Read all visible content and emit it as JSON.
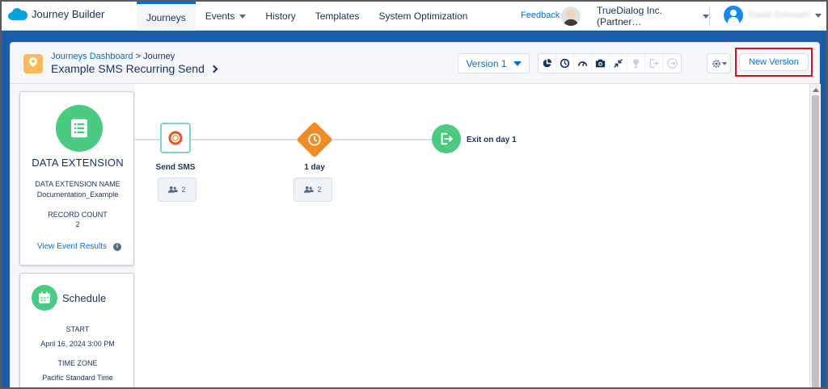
{
  "app": {
    "name": "Journey Builder"
  },
  "nav": {
    "tabs": [
      {
        "label": "Journeys",
        "active": true,
        "has_menu": false
      },
      {
        "label": "Events",
        "active": false,
        "has_menu": true
      },
      {
        "label": "History",
        "active": false,
        "has_menu": false
      },
      {
        "label": "Templates",
        "active": false,
        "has_menu": false
      },
      {
        "label": "System Optimization",
        "active": false,
        "has_menu": false
      }
    ],
    "feedback": "Feedback",
    "org": "TrueDialog Inc. (Partner…",
    "user": "David Schonert"
  },
  "header": {
    "breadcrumb_link": "Journeys Dashboard",
    "breadcrumb_sep": ">",
    "breadcrumb_current": "Journey",
    "journey_name": "Example SMS Recurring Send",
    "version_label": "Version 1",
    "new_version_label": "New Version",
    "tools": [
      "pie-chart-icon",
      "history-icon",
      "gauge-icon",
      "camera-icon",
      "collapse-icon",
      "trophy-icon",
      "exit-icon",
      "exit-criteria-icon"
    ]
  },
  "entry_source": {
    "title": "DATA EXTENSION",
    "name_label": "DATA EXTENSION NAME",
    "name_value": "Documentation_Example",
    "count_label": "RECORD COUNT",
    "count_value": "2",
    "event_link": "View Event Results"
  },
  "schedule": {
    "title": "Schedule",
    "start_label": "START",
    "start_value": "April 16, 2024 3:00 PM",
    "tz_label": "TIME ZONE",
    "tz_value": "Pacific Standard Time"
  },
  "canvas": {
    "sms": {
      "label": "Send SMS",
      "count": "2"
    },
    "wait": {
      "label": "1 day",
      "count": "2"
    },
    "exit": {
      "label": "Exit on day 1"
    }
  },
  "colors": {
    "accent": "#0070d2",
    "background": "#1b5ea7",
    "green": "#4bca81",
    "orange": "#f08a24",
    "highlight": "#d0141a"
  }
}
